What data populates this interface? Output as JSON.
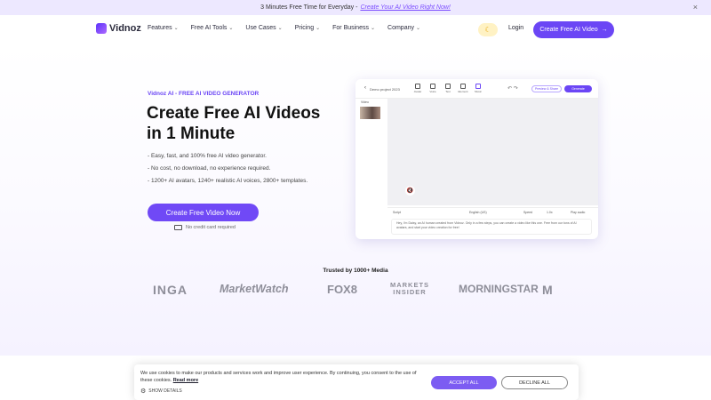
{
  "promo": {
    "text": "3 Minutes Free Time for Everyday - ",
    "link": "Create Your AI Video Right Now!",
    "close": "×"
  },
  "nav": {
    "logo": "Vidnoz",
    "items": [
      {
        "label": "Features"
      },
      {
        "label": "Free AI Tools"
      },
      {
        "label": "Use Cases"
      },
      {
        "label": "Pricing"
      },
      {
        "label": "For Business"
      },
      {
        "label": "Company"
      }
    ],
    "login": "Login",
    "cta": "Create Free AI Video",
    "cta_arrow": "→"
  },
  "hero": {
    "tag": "Vidnoz AI - FREE AI VIDEO GENERATOR",
    "title_line1": "Create Free AI Videos",
    "title_line2": "in 1 Minute",
    "bullets": [
      "- Easy, fast, and 100% free AI video generator.",
      "- No cost, no download, no experience required.",
      "- 1200+ AI avatars, 1240+ realistic AI voices, 2800+ templates."
    ],
    "button": "Create Free Video Now",
    "no_card": "No credit card required"
  },
  "editor": {
    "project_name": "Demo project 2023",
    "tools": [
      "Avatar",
      "Voice",
      "Text",
      "Element",
      "Music"
    ],
    "share": "Preview & Share",
    "generate": "Generate",
    "side_label": "Video",
    "script_left": "Script",
    "script_lang": "English (US)",
    "script_speed": "Speed",
    "script_pitch": "1.0x",
    "script_play": "Play audio",
    "script_text": "Hey, I'm Daisy, an AI human created from Vidnoz. Only in a few steps, you can create a video like this one. Free from our tons of AI avatars, and start your video creation for free!"
  },
  "trusted": {
    "title": "Trusted by 1000+ Media",
    "brands": [
      "INGA",
      "MarketWatch",
      "FOX8",
      "MARKETS INSIDER",
      "MORNINGSTAR",
      "M"
    ]
  },
  "cookie": {
    "text": "We use cookies to make our products and services work and improve user experience. By continuing, you consent to the use of these cookies.",
    "read_more": "Read more",
    "details": "SHOW DETAILS",
    "accept": "ACCEPT ALL",
    "decline": "DECLINE ALL"
  },
  "colors": {
    "accent": "#6b46f5",
    "promo_bg": "#ede8ff",
    "brand_gray": "#8e8e99"
  }
}
